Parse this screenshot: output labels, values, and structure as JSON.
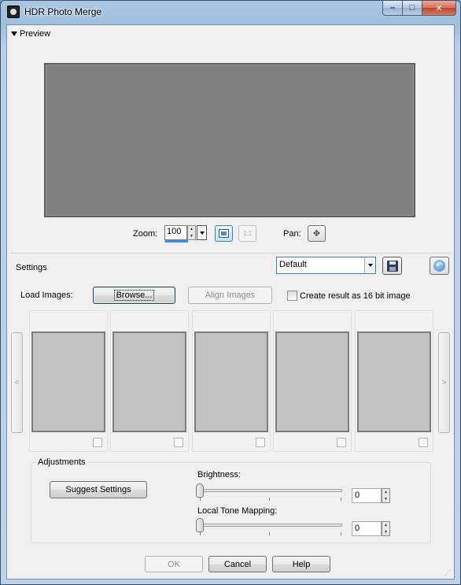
{
  "window": {
    "title": "HDR Photo Merge",
    "minimize": "–",
    "maximize": "□",
    "close": "✕"
  },
  "preview": {
    "toggle_label": "Preview",
    "zoom_label": "Zoom:",
    "zoom_value": "100",
    "actual_size_label": "1:1",
    "pan_label": "Pan:",
    "pan_icon": "✥"
  },
  "settings": {
    "label": "Settings",
    "preset_value": "Default"
  },
  "load": {
    "label": "Load Images:",
    "browse_label": "Browse...",
    "align_label": "Align Images",
    "create16_label": "Create result as 16 bit image"
  },
  "thumbnails": {
    "prev_label": "<",
    "next_label": ">",
    "count": 5
  },
  "adjustments": {
    "label": "Adjustments",
    "suggest_label": "Suggest Settings",
    "brightness_label": "Brightness:",
    "brightness_value": "0",
    "tone_label": "Local Tone Mapping:",
    "tone_value": "0"
  },
  "footer": {
    "ok_label": "OK",
    "cancel_label": "Cancel",
    "help_label": "Help"
  },
  "icons": {
    "app": "hdr-app-icon",
    "preview_toggle": "triangle-down-icon",
    "fit": "fit-to-window-icon",
    "pan": "pan-icon",
    "save": "floppy-disk-icon",
    "reset": "reset-icon"
  }
}
